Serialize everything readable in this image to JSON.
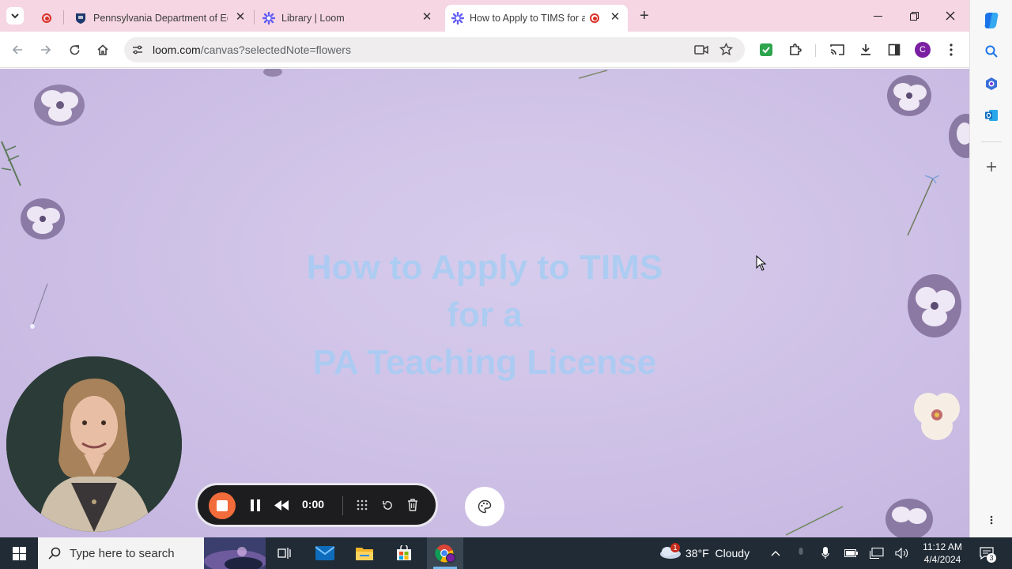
{
  "browser": {
    "tabs": [
      {
        "title": "",
        "icon": "recording-icon",
        "active": false
      },
      {
        "title": "Pennsylvania Department of Ed",
        "icon": "pa-shield-icon",
        "active": false
      },
      {
        "title": "Library | Loom",
        "icon": "loom-icon",
        "active": false
      },
      {
        "title": "How to Apply to TIMS for a",
        "icon": "loom-icon",
        "active": true,
        "recording": true
      }
    ],
    "new_tab_label": "+",
    "url_host": "loom.com",
    "url_path": "/canvas?selectedNote=flowers",
    "profile_initial": "C"
  },
  "content": {
    "headline_line1": "How to Apply to TIMS",
    "headline_line2": "for a",
    "headline_line3": "PA Teaching License"
  },
  "recorder": {
    "timer": "0:00"
  },
  "taskbar": {
    "search_placeholder": "Type here to search",
    "weather": "38°F  Cloudy",
    "time": "11:12 AM",
    "date": "4/4/2024",
    "notification_count": "3",
    "weather_alert": "1"
  },
  "colors": {
    "tabstrip": "#f6d6e2",
    "canvas": "#cfc2e7",
    "headline": "#a7cdf4",
    "stop_button": "#f26b3a",
    "taskbar": "#202b36"
  }
}
